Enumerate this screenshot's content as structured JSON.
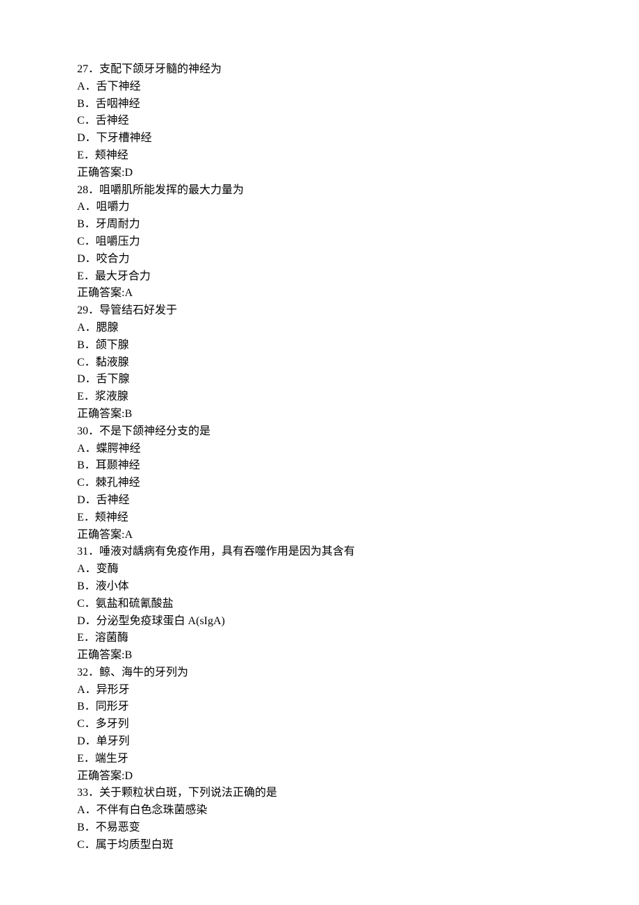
{
  "questions": [
    {
      "number": "27",
      "stem": "支配下颌牙牙髓的神经为",
      "options": [
        "A．舌下神经",
        "B．舌咽神经",
        "C．舌神经",
        "D．下牙槽神经",
        "E．颊神经"
      ],
      "answer_label": "正确答案:",
      "answer": "D"
    },
    {
      "number": "28",
      "stem": "咀嚼肌所能发挥的最大力量为",
      "options": [
        "A．咀嚼力",
        "B．牙周耐力",
        "C．咀嚼压力",
        "D．咬合力",
        "E．最大牙合力"
      ],
      "answer_label": "正确答案:",
      "answer": "A"
    },
    {
      "number": "29",
      "stem": "导管结石好发于",
      "options": [
        "A．腮腺",
        "B．颌下腺",
        "C．黏液腺",
        "D．舌下腺",
        "E．浆液腺"
      ],
      "answer_label": "正确答案:",
      "answer": "B"
    },
    {
      "number": "30",
      "stem": "不是下颌神经分支的是",
      "options": [
        "A．蝶腭神经",
        "B．耳颞神经",
        "C．棘孔神经",
        "D．舌神经",
        "E．颊神经"
      ],
      "answer_label": "正确答案:",
      "answer": "A"
    },
    {
      "number": "31",
      "stem": "唾液对龋病有免疫作用，具有吞噬作用是因为其含有",
      "options": [
        "A．变酶",
        "B．液小体",
        "C．氨盐和硫氰酸盐",
        "D．分泌型免疫球蛋白 A(sIgA)",
        "E．溶菌酶"
      ],
      "answer_label": "正确答案:",
      "answer": "B"
    },
    {
      "number": "32",
      "stem": "鲸、海牛的牙列为",
      "options": [
        "A．异形牙",
        "B．同形牙",
        "C．多牙列",
        "D．单牙列",
        "E．端生牙"
      ],
      "answer_label": "正确答案:",
      "answer": "D"
    },
    {
      "number": "33",
      "stem": "关于颗粒状白斑，下列说法正确的是",
      "options": [
        "A．不伴有白色念珠菌感染",
        "B．不易恶变",
        "C．属于均质型白斑"
      ],
      "answer_label": "",
      "answer": ""
    }
  ]
}
